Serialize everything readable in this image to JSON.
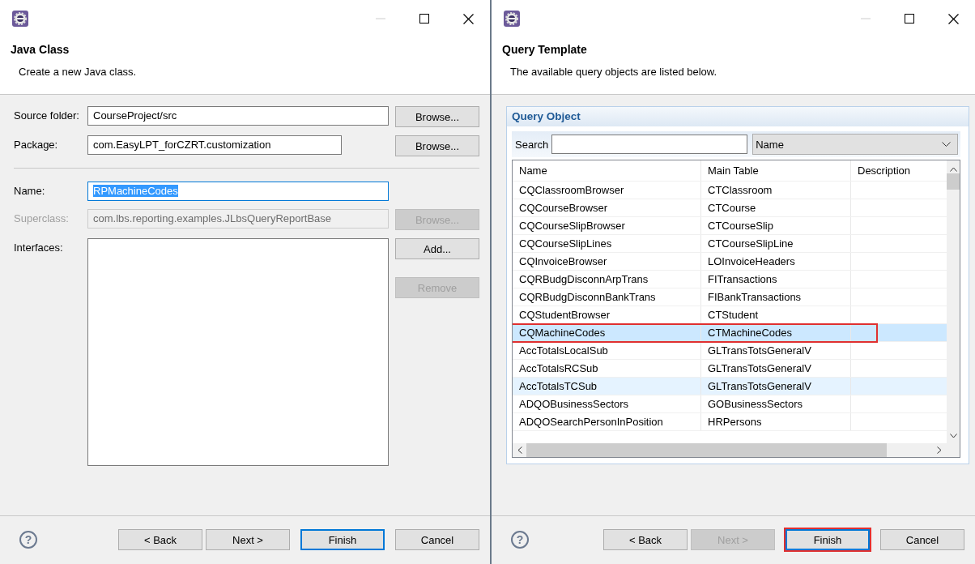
{
  "left_dialog": {
    "title": "Java Class",
    "subtitle": "Create a new Java class.",
    "groups": [
      {
        "fields": [
          {
            "label": "Source folder:",
            "value": "CourseProject/src",
            "kind": "text",
            "narrow": false,
            "disabled": false,
            "focused": false,
            "buttons": [
              {
                "label": "Browse...",
                "disabled": false
              }
            ]
          },
          {
            "label": "Package:",
            "value": "com.EasyLPT_forCZRT.customization",
            "kind": "text",
            "narrow": true,
            "disabled": false,
            "focused": false,
            "buttons": [
              {
                "label": "Browse...",
                "disabled": false
              }
            ]
          }
        ]
      },
      {
        "fields": [
          {
            "label": "Name:",
            "value": "RPMachineCodes",
            "kind": "text",
            "narrow": false,
            "disabled": false,
            "focused": true
          },
          {
            "label": "Superclass:",
            "value": "com.lbs.reporting.examples.JLbsQueryReportBase",
            "kind": "text",
            "narrow": false,
            "disabled": true,
            "focused": false,
            "buttons": [
              {
                "label": "Browse...",
                "disabled": true
              }
            ]
          },
          {
            "label": "Interfaces:",
            "kind": "list",
            "buttons": [
              {
                "label": "Add...",
                "disabled": false
              },
              {
                "label": "Remove",
                "disabled": true
              }
            ]
          }
        ]
      }
    ],
    "help": "?",
    "buttons": [
      {
        "label": "< Back",
        "disabled": false,
        "default": false,
        "highlighted": false
      },
      {
        "label": "Next >",
        "disabled": false,
        "default": false,
        "highlighted": false
      },
      {
        "label": "Finish",
        "disabled": false,
        "default": true,
        "highlighted": false
      },
      {
        "label": "Cancel",
        "disabled": false,
        "default": false,
        "highlighted": false
      }
    ]
  },
  "right_dialog": {
    "title": "Query Template",
    "subtitle": "The available query objects are listed below.",
    "group_title": "Query Object",
    "search_label": "Search",
    "filter": "Name",
    "columns": [
      "Name",
      "Main Table",
      "Description"
    ],
    "rows": [
      {
        "cells": [
          "CQClassroomBrowser",
          "CTClassroom"
        ],
        "selected": false,
        "hovered": false,
        "highlighted": false
      },
      {
        "cells": [
          "CQCourseBrowser",
          "CTCourse"
        ],
        "selected": false,
        "hovered": false,
        "highlighted": false
      },
      {
        "cells": [
          "CQCourseSlipBrowser",
          "CTCourseSlip"
        ],
        "selected": false,
        "hovered": false,
        "highlighted": false
      },
      {
        "cells": [
          "CQCourseSlipLines",
          "CTCourseSlipLine"
        ],
        "selected": false,
        "hovered": false,
        "highlighted": false
      },
      {
        "cells": [
          "CQInvoiceBrowser",
          "LOInvoiceHeaders"
        ],
        "selected": false,
        "hovered": false,
        "highlighted": false
      },
      {
        "cells": [
          "CQRBudgDisconnArpTrans",
          "FITransactions"
        ],
        "selected": false,
        "hovered": false,
        "highlighted": false
      },
      {
        "cells": [
          "CQRBudgDisconnBankTrans",
          "FIBankTransactions"
        ],
        "selected": false,
        "hovered": false,
        "highlighted": false
      },
      {
        "cells": [
          "CQStudentBrowser",
          "CTStudent"
        ],
        "selected": false,
        "hovered": false,
        "highlighted": false
      },
      {
        "cells": [
          "CQMachineCodes",
          "CTMachineCodes"
        ],
        "selected": true,
        "hovered": false,
        "highlighted": true
      },
      {
        "cells": [
          "AccTotalsLocalSub",
          "GLTransTotsGeneralV"
        ],
        "selected": false,
        "hovered": false,
        "highlighted": false
      },
      {
        "cells": [
          "AccTotalsRCSub",
          "GLTransTotsGeneralV"
        ],
        "selected": false,
        "hovered": false,
        "highlighted": false
      },
      {
        "cells": [
          "AccTotalsTCSub",
          "GLTransTotsGeneralV"
        ],
        "selected": false,
        "hovered": true,
        "highlighted": false
      },
      {
        "cells": [
          "ADQOBusinessSectors",
          "GOBusinessSectors"
        ],
        "selected": false,
        "hovered": false,
        "highlighted": false
      },
      {
        "cells": [
          "ADQOSearchPersonInPosition",
          "HRPersons"
        ],
        "selected": false,
        "hovered": false,
        "highlighted": false
      }
    ],
    "help": "?",
    "buttons": [
      {
        "label": "< Back",
        "disabled": false,
        "default": false,
        "highlighted": false
      },
      {
        "label": "Next >",
        "disabled": true,
        "default": false,
        "highlighted": false
      },
      {
        "label": "Finish",
        "disabled": false,
        "default": true,
        "highlighted": true
      },
      {
        "label": "Cancel",
        "disabled": false,
        "default": false,
        "highlighted": false
      }
    ]
  }
}
